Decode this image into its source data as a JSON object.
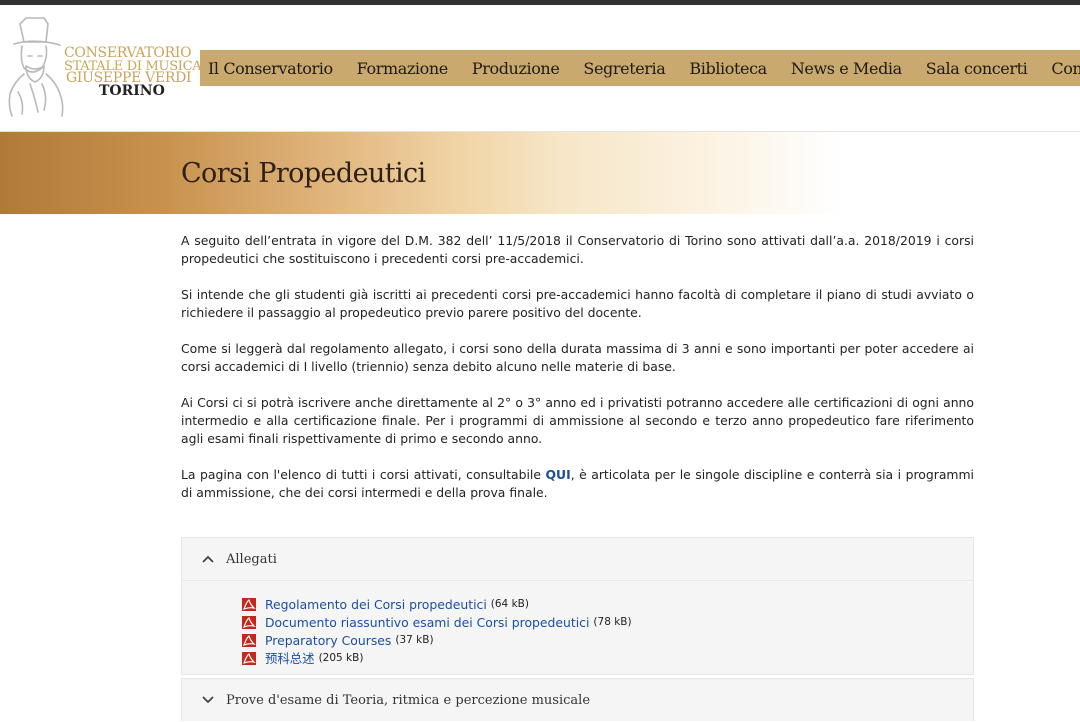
{
  "logo": {
    "line1": "CONSERVATORIO",
    "line2": "STATALE DI MUSICA",
    "line3": "GIUSEPPE VERDI",
    "line4": "TORINO"
  },
  "nav": {
    "items": [
      "Il Conservatorio",
      "Formazione",
      "Produzione",
      "Segreteria",
      "Biblioteca",
      "News e Media",
      "Sala concerti",
      "Cont"
    ]
  },
  "page": {
    "title": "Corsi Propedeutici",
    "paragraphs": [
      "A seguito dell’entrata in vigore del D.M. 382 dell’ 11/5/2018 il Conservatorio di Torino sono attivati dall’a.a. 2018/2019 i corsi propedeutici che sostituiscono i precedenti corsi pre-accademici.",
      "Si intende che gli studenti già iscritti ai precedenti corsi pre-accademici hanno facoltà di completare il piano di studi avviato o richiedere il passaggio al propedeutico previo parere positivo del docente.",
      "Come si leggerà dal regolamento allegato, i corsi sono della durata massima di 3 anni e sono importanti per poter accedere ai corsi accademici di I livello (triennio) senza debito alcuno nelle materie di base.",
      "Ai Corsi ci si potrà iscrivere anche direttamente al 2° o 3° anno ed i privatisti potranno accedere alle certificazioni di ogni anno intermedio e alla certificazione finale. Per i programmi di ammissione al secondo e terzo anno propedeutico fare riferimento agli esami finali rispettivamente di primo e secondo anno."
    ],
    "last_paragraph": {
      "before": "La pagina con l'elenco di tutti i corsi attivati, consultabile ",
      "link": "QUI",
      "after": ", è articolata per le singole discipline e conterrà sia i programmi di ammissione, che dei corsi intermedi e della prova finale."
    }
  },
  "attachments": {
    "title": "Allegati",
    "expanded": true,
    "files": [
      {
        "name": "Regolamento dei Corsi propedeutici",
        "size": "(64 kB)",
        "icon": "pdf-icon"
      },
      {
        "name": "Documento riassuntivo esami dei Corsi propedeutici",
        "size": "(78 kB)",
        "icon": "pdf-icon"
      },
      {
        "name": "Preparatory Courses",
        "size": "(37 kB)",
        "icon": "pdf-icon"
      },
      {
        "name": "预科总述",
        "size": "(205 kB)",
        "icon": "pdf-icon"
      }
    ]
  },
  "exam_section": {
    "title": "Prove d'esame di Teoria, ritmica e percezione musicale",
    "expanded": false
  },
  "colors": {
    "nav_bg": "#c9a96e",
    "logo_gold": "#c9a45a",
    "link": "#1a4fa3",
    "topbar": "#333333"
  }
}
